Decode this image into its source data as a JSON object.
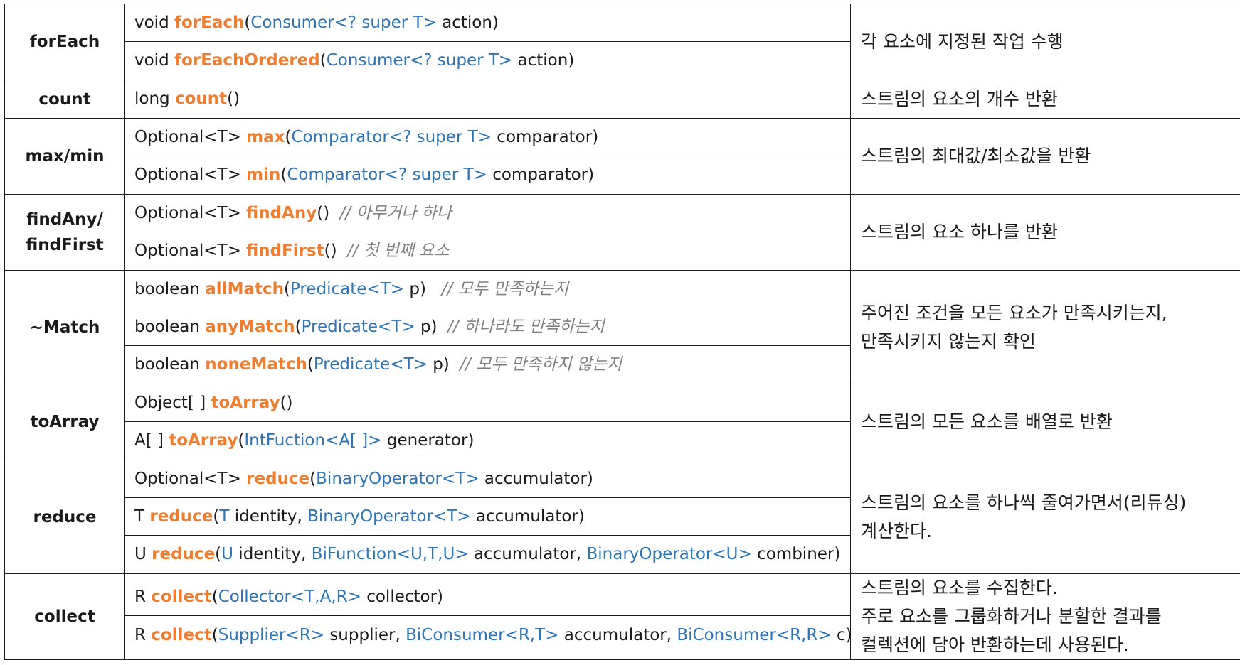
{
  "rows": [
    {
      "name": "forEach",
      "sigs": [
        [
          [
            "p",
            "void "
          ],
          [
            "m",
            "forEach"
          ],
          [
            "p",
            "("
          ],
          [
            "t",
            "Consumer<? super T>"
          ],
          [
            "p",
            " action)"
          ]
        ],
        [
          [
            "p",
            "void "
          ],
          [
            "m",
            "forEachOrdered"
          ],
          [
            "p",
            "("
          ],
          [
            "t",
            "Consumer<? super T>"
          ],
          [
            "p",
            " action)"
          ]
        ]
      ],
      "desc": [
        "각 요소에 지정된 작업 수행"
      ]
    },
    {
      "name": "count",
      "sigs": [
        [
          [
            "p",
            "long "
          ],
          [
            "m",
            "count"
          ],
          [
            "p",
            "()"
          ]
        ]
      ],
      "desc": [
        "스트림의 요소의 개수 반환"
      ]
    },
    {
      "name": "max/min",
      "sigs": [
        [
          [
            "p",
            "Optional<T> "
          ],
          [
            "m",
            "max"
          ],
          [
            "p",
            "("
          ],
          [
            "t",
            "Comparator<? super T>"
          ],
          [
            "p",
            " comparator)"
          ]
        ],
        [
          [
            "p",
            "Optional<T> "
          ],
          [
            "m",
            "min"
          ],
          [
            "p",
            "("
          ],
          [
            "t",
            "Comparator<? super T>"
          ],
          [
            "p",
            " comparator)"
          ]
        ]
      ],
      "desc": [
        "스트림의 최대값/최소값을 반환"
      ]
    },
    {
      "name": "findAny/\nfindFirst",
      "sigs": [
        [
          [
            "p",
            "Optional<T> "
          ],
          [
            "m",
            "findAny"
          ],
          [
            "p",
            "()  "
          ],
          [
            "c",
            "// 아무거나 하나"
          ]
        ],
        [
          [
            "p",
            "Optional<T> "
          ],
          [
            "m",
            "findFirst"
          ],
          [
            "p",
            "()  "
          ],
          [
            "c",
            "// 첫 번째 요소"
          ]
        ]
      ],
      "desc": [
        "스트림의 요소 하나를 반환"
      ]
    },
    {
      "name": "~Match",
      "sigs": [
        [
          [
            "p",
            "boolean "
          ],
          [
            "m",
            "allMatch"
          ],
          [
            "p",
            "("
          ],
          [
            "t",
            "Predicate<T>"
          ],
          [
            "p",
            " p)   "
          ],
          [
            "c",
            "// 모두 만족하는지"
          ]
        ],
        [
          [
            "p",
            "boolean "
          ],
          [
            "m",
            "anyMatch"
          ],
          [
            "p",
            "("
          ],
          [
            "t",
            "Predicate<T>"
          ],
          [
            "p",
            " p)  "
          ],
          [
            "c",
            "// 하나라도 만족하는지"
          ]
        ],
        [
          [
            "p",
            "boolean "
          ],
          [
            "m",
            "noneMatch"
          ],
          [
            "p",
            "("
          ],
          [
            "t",
            "Predicate<T>"
          ],
          [
            "p",
            " p)  "
          ],
          [
            "c",
            "// 모두 만족하지 않는지"
          ]
        ]
      ],
      "desc": [
        "주어진 조건을 모든 요소가 만족시키는지,",
        "만족시키지 않는지 확인"
      ]
    },
    {
      "name": "toArray",
      "sigs": [
        [
          [
            "p",
            "Object[ ] "
          ],
          [
            "m",
            "toArray"
          ],
          [
            "p",
            "()"
          ]
        ],
        [
          [
            "p",
            "A[ ] "
          ],
          [
            "m",
            "toArray"
          ],
          [
            "p",
            "("
          ],
          [
            "t",
            "IntFuction<A[ ]>"
          ],
          [
            "p",
            " generator)"
          ]
        ]
      ],
      "desc": [
        "스트림의 모든 요소를 배열로 반환"
      ]
    },
    {
      "name": "reduce",
      "sigs": [
        [
          [
            "p",
            "Optional<T> "
          ],
          [
            "m",
            "reduce"
          ],
          [
            "p",
            "("
          ],
          [
            "t",
            "BinaryOperator<T>"
          ],
          [
            "p",
            " accumulator)"
          ]
        ],
        [
          [
            "p",
            "T "
          ],
          [
            "m",
            "reduce"
          ],
          [
            "p",
            "("
          ],
          [
            "t",
            "T"
          ],
          [
            "p",
            " identity, "
          ],
          [
            "t",
            "BinaryOperator<T>"
          ],
          [
            "p",
            " accumulator)"
          ]
        ],
        [
          [
            "p",
            "U "
          ],
          [
            "m",
            "reduce"
          ],
          [
            "p",
            "("
          ],
          [
            "t",
            "U"
          ],
          [
            "p",
            " identity, "
          ],
          [
            "t",
            "BiFunction<U,T,U>"
          ],
          [
            "p",
            " accumulator, "
          ],
          [
            "t",
            "BinaryOperator<U>"
          ],
          [
            "p",
            " combiner)"
          ]
        ]
      ],
      "desc": [
        "스트림의 요소를 하나씩 줄여가면서(리듀싱)",
        "계산한다."
      ]
    },
    {
      "name": "collect",
      "sigs": [
        [
          [
            "p",
            "R "
          ],
          [
            "m",
            "collect"
          ],
          [
            "p",
            "("
          ],
          [
            "t",
            "Collector<T,A,R>"
          ],
          [
            "p",
            " collector)"
          ]
        ],
        [
          [
            "p",
            "R "
          ],
          [
            "m",
            "collect"
          ],
          [
            "p",
            "("
          ],
          [
            "t",
            "Supplier<R>"
          ],
          [
            "p",
            " supplier, "
          ],
          [
            "t",
            "BiConsumer<R,T>"
          ],
          [
            "p",
            " accumulator, "
          ],
          [
            "t",
            "BiConsumer<R,R>"
          ],
          [
            "p",
            " c)"
          ]
        ]
      ],
      "desc": [
        "스트림의 요소를 수집한다.",
        "주로 요소를 그룹화하거나 분할한 결과를",
        "컬렉션에 담아 반환하는데 사용된다."
      ]
    }
  ],
  "colors": {
    "method": "#ed7d31",
    "type": "#2e75b6",
    "comment": "#7f7f7f",
    "border": "#1a1a1a"
  }
}
